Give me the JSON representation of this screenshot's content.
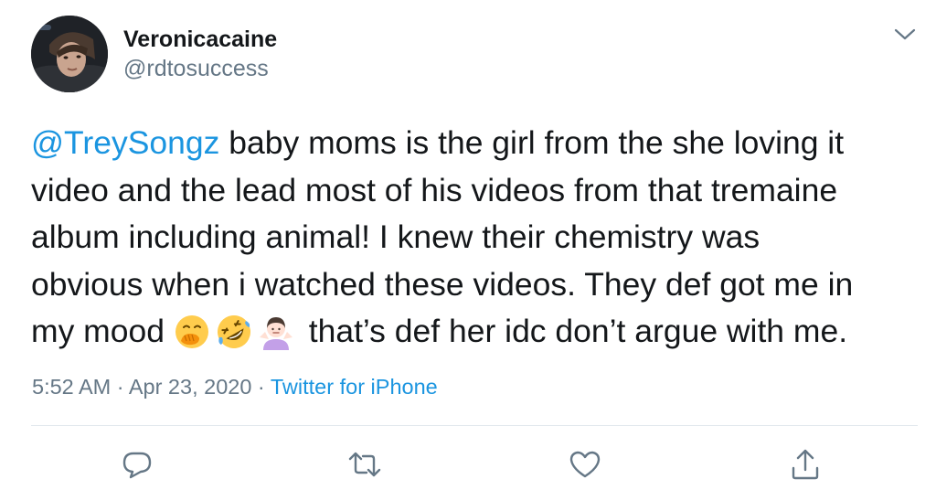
{
  "user": {
    "display_name": "Veronicacaine",
    "handle": "@rdtosuccess"
  },
  "tweet": {
    "lines": [
      {
        "mention": "@TreySongz",
        "text": " baby moms is the girl from the she loving it"
      },
      {
        "text": "video and the lead most of his videos from that tremaine"
      },
      {
        "text": "album including animal! I knew their chemistry was"
      },
      {
        "text": "obvious when i watched these videos. They def got me in"
      },
      {
        "text": "my mood ",
        "emojis": [
          "face-with-hand-over-mouth",
          "rolling-on-floor-laughing",
          "woman-shrugging"
        ],
        "tail": " that’s def her idc don’t argue with me."
      }
    ]
  },
  "meta": {
    "time": "5:52 AM",
    "sep1": " · ",
    "date": "Apr 23, 2020",
    "sep2": " · ",
    "source": "Twitter for iPhone"
  },
  "icons": {
    "more": "chevron-down-icon",
    "reply": "reply-icon",
    "retweet": "retweet-icon",
    "like": "heart-icon",
    "share": "share-icon"
  },
  "colors": {
    "link": "#1b95e0",
    "secondary": "#657786",
    "icon": "#657786",
    "divider": "#e1e8ed"
  }
}
